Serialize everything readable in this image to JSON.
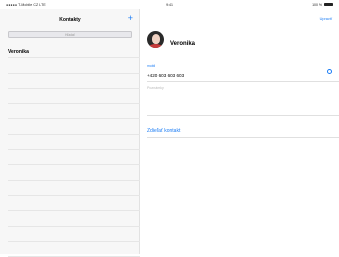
{
  "status_bar": {
    "carrier": "●●●●● T-Mobile CZ  LTE",
    "time": "9:41",
    "battery_pct": "100 %"
  },
  "sidebar": {
    "title": "Kontakty",
    "add_label": "+",
    "search_placeholder": "Hľadať",
    "contacts": [
      "Veronika"
    ],
    "empty_rows": 13
  },
  "detail": {
    "edit_label": "Upraviť",
    "contact_name": "Veronika",
    "phone_label": "mobil",
    "phone_number": "+420 603 603 603",
    "notes_placeholder": "Poznámky",
    "share_label": "Zdieľať kontakt"
  },
  "colors": {
    "accent": "#1a7cf5",
    "sidebar_bg": "#f7f7f7"
  },
  "icons": {
    "add": "plus-icon",
    "message": "message-icon",
    "battery": "battery-icon"
  }
}
